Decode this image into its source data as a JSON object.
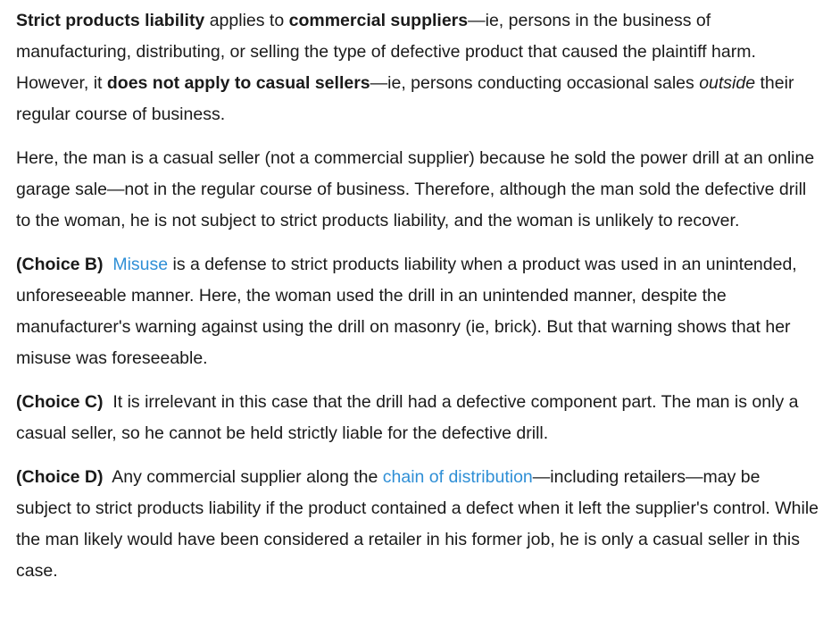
{
  "p1": {
    "t1": "Strict products liability",
    "t2": " applies to ",
    "t3": "commercial suppliers",
    "t4": "—ie, persons in the business of manufacturing, distributing, or selling the type of defective product that caused the plaintiff harm.  However, it ",
    "t5": "does not apply to casual sellers",
    "t6": "—ie, persons conducting occasional sales ",
    "t7": "outside",
    "t8": " their regular course of business."
  },
  "p2": {
    "text": "Here, the man is a casual seller (not a commercial supplier) because he sold the power drill at an online garage sale—not in the regular course of business.  Therefore, although the man sold the defective drill to the woman, he is not subject to strict products liability, and the woman is unlikely to recover."
  },
  "p3": {
    "label": "(Choice B)",
    "link": "Misuse",
    "text": " is a defense to strict products liability when a product was used in an unintended, unforeseeable manner.  Here, the woman used the drill in an unintended manner, despite the manufacturer's warning against using the drill on masonry (ie, brick).  But that warning shows that her misuse was foreseeable."
  },
  "p4": {
    "label": "(Choice C)",
    "text": "It is irrelevant in this case that the drill had a defective component part.  The man is only a casual seller, so he cannot be held strictly liable for the defective drill."
  },
  "p5": {
    "label": "(Choice D)",
    "t1": "Any commercial supplier along the ",
    "link": "chain of distribution",
    "t2": "—including retailers—may be subject to strict products liability if the product contained a defect when it left the supplier's control.  While the man likely would have been considered a retailer in his former job, he is only a casual seller in this case."
  },
  "colors": {
    "text": "#1a1a1a",
    "link": "#2f8fd6"
  }
}
